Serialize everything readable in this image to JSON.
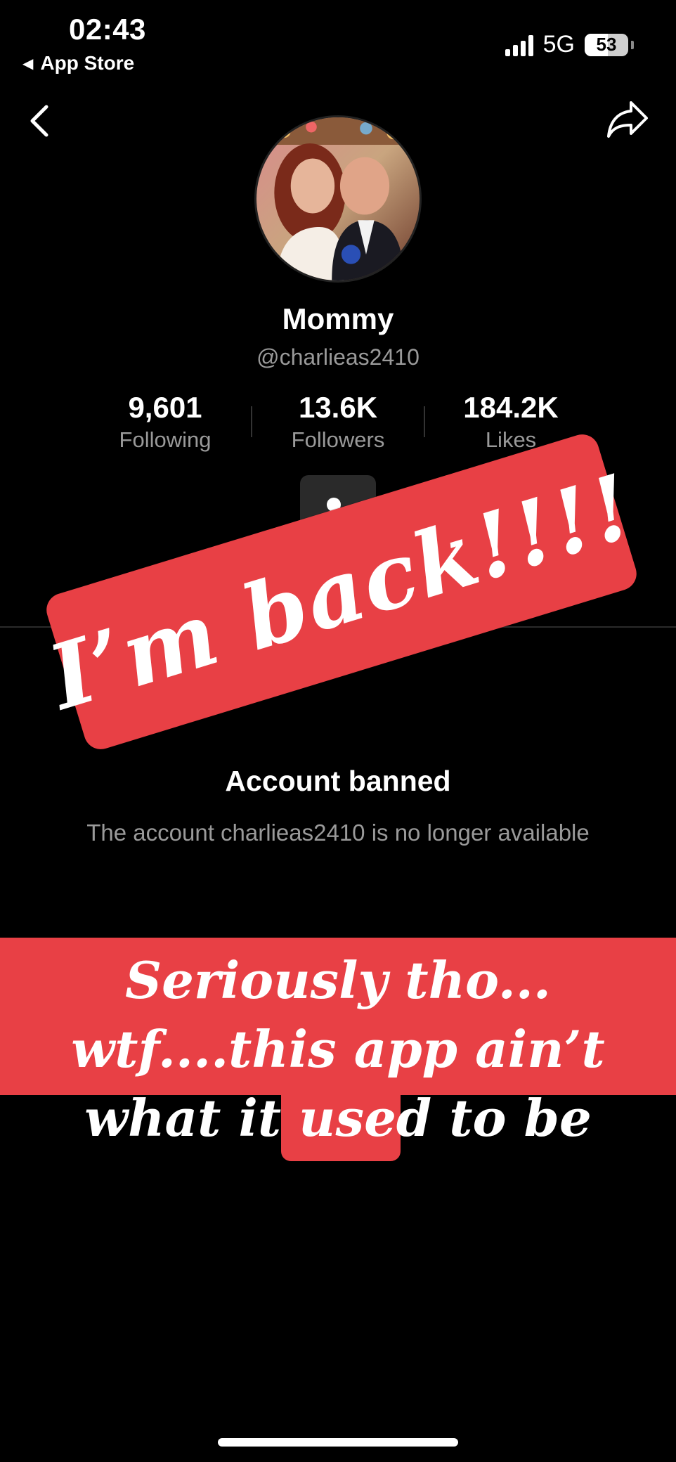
{
  "status_bar": {
    "time": "02:43",
    "back_app": "App Store",
    "network": "5G",
    "battery": "53",
    "battery_level": 0.53
  },
  "nav": {
    "back_icon": "chevron-left-icon",
    "share_icon": "share-arrow-icon"
  },
  "profile": {
    "display_name": "Mommy",
    "handle": "@charlieas2410",
    "stats": [
      {
        "value": "9,601",
        "label": "Following"
      },
      {
        "value": "13.6K",
        "label": "Followers"
      },
      {
        "value": "184.2K",
        "label": "Likes"
      }
    ],
    "friend_icon": "add-friend-icon"
  },
  "ban_notice": {
    "title": "Account banned",
    "description": "The account charlieas2410 is no longer available"
  },
  "overlays": {
    "sticker": "I’m back!!!!",
    "caption": "Seriously tho... wtf....this app ain’t what it used to be"
  },
  "colors": {
    "background": "#000000",
    "overlay_red": "#e84045",
    "muted_text": "#9a9a9a"
  }
}
